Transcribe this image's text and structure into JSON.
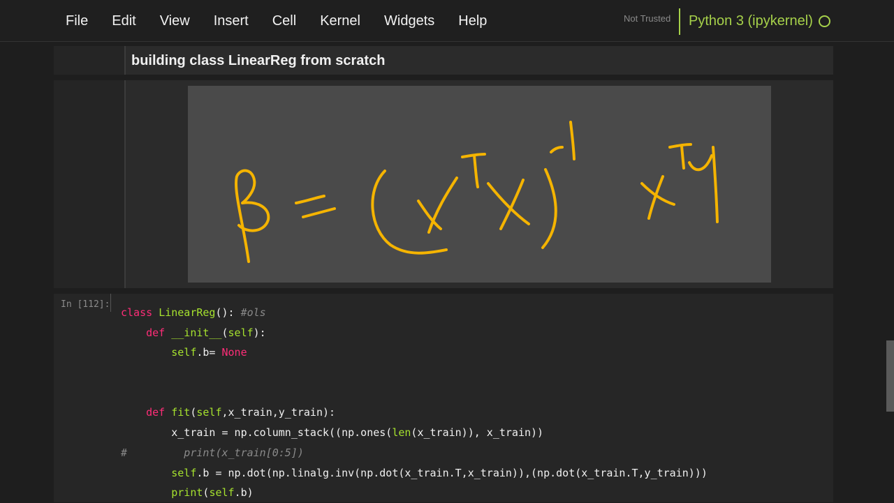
{
  "menubar": {
    "items": [
      "File",
      "Edit",
      "View",
      "Insert",
      "Cell",
      "Kernel",
      "Widgets",
      "Help"
    ],
    "trust_label": "Not Trusted",
    "kernel_label": "Python 3 (ipykernel)",
    "kernel_status_icon": "circle-outline-icon"
  },
  "markdown_cell": {
    "title": "building class LinearReg from scratch"
  },
  "formula_image": {
    "description_icon": "handwritten-formula-image",
    "stroke_color": "#f5b400",
    "background_color": "#4a4a4a"
  },
  "code_cell": {
    "prompt": "In [112]:",
    "lines": [
      {
        "text": "class LinearReg(): #ols"
      },
      {
        "text": "    def __init__(self):"
      },
      {
        "text": "        self.b= None"
      },
      {
        "text": ""
      },
      {
        "text": ""
      },
      {
        "text": "    def fit(self,x_train,y_train):"
      },
      {
        "text": "        x_train = np.column_stack((np.ones(len(x_train)), x_train))"
      },
      {
        "text": "#         print(x_train[0:5])"
      },
      {
        "text": "        self.b = np.dot(np.linalg.inv(np.dot(x_train.T,x_train)),(np.dot(x_train.T,y_train)))"
      },
      {
        "text": "        print(self.b)"
      }
    ]
  },
  "colors": {
    "kernel_accent": "#a6d14a",
    "keyword": "#ff2d78",
    "name": "#a6e22e",
    "comment": "#8a8a8a"
  }
}
